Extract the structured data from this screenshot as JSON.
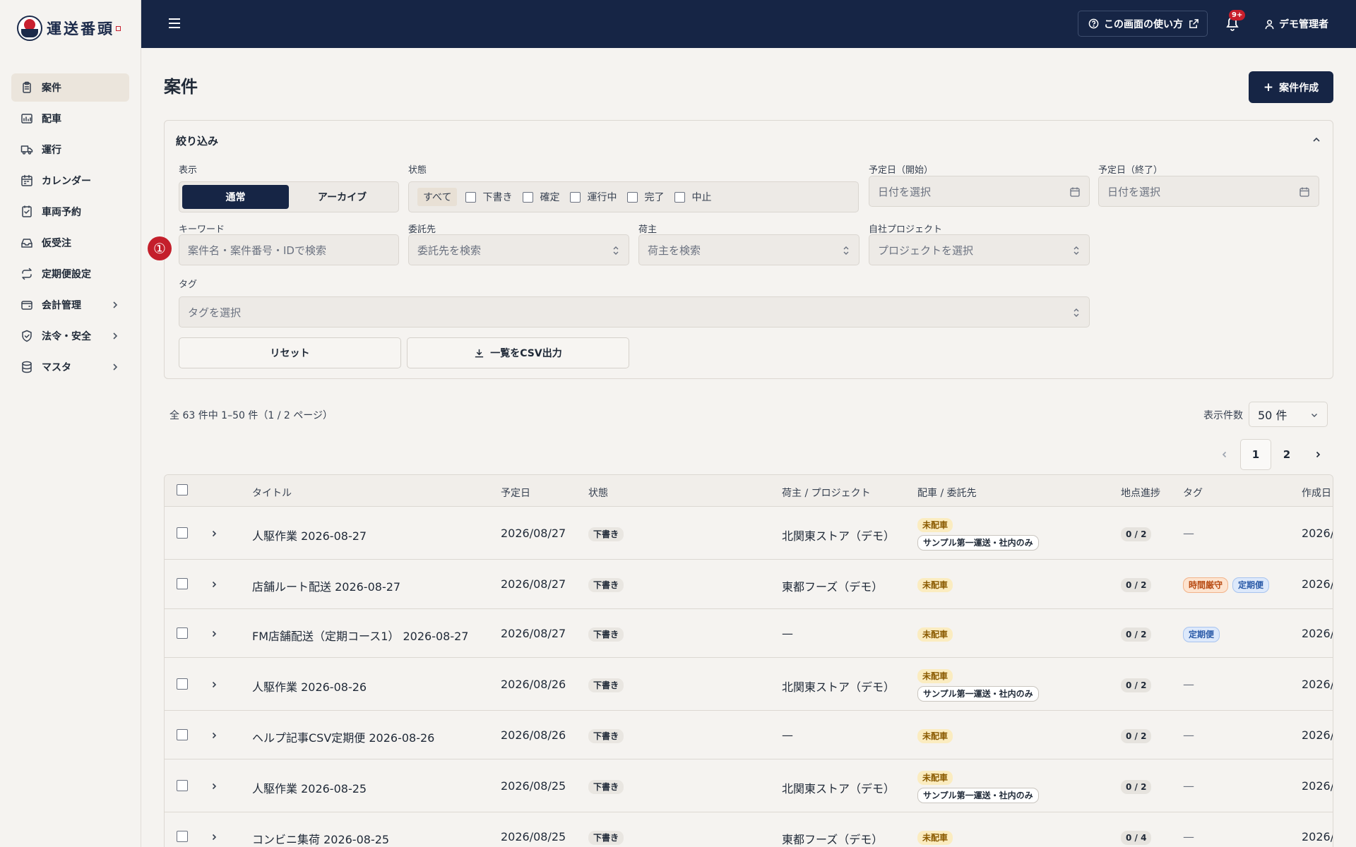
{
  "brand": {
    "name": "運送番頭"
  },
  "sidebar": {
    "items": [
      {
        "label": "案件",
        "icon": "clipboard-icon",
        "active": true,
        "expandable": false
      },
      {
        "label": "配車",
        "icon": "dispatch-map-icon",
        "active": false,
        "expandable": false
      },
      {
        "label": "運行",
        "icon": "truck-icon",
        "active": false,
        "expandable": false
      },
      {
        "label": "カレンダー",
        "icon": "calendar-icon",
        "active": false,
        "expandable": false
      },
      {
        "label": "車両予約",
        "icon": "calendar-check-icon",
        "active": false,
        "expandable": false
      },
      {
        "label": "仮受注",
        "icon": "inbox-icon",
        "active": false,
        "expandable": false
      },
      {
        "label": "定期便設定",
        "icon": "repeat-icon",
        "active": false,
        "expandable": false
      },
      {
        "label": "会計管理",
        "icon": "wallet-icon",
        "active": false,
        "expandable": true
      },
      {
        "label": "法令・安全",
        "icon": "shield-check-icon",
        "active": false,
        "expandable": true
      },
      {
        "label": "マスタ",
        "icon": "database-icon",
        "active": false,
        "expandable": true
      }
    ]
  },
  "topbar": {
    "help_label": "この画面の使い方",
    "notification_badge": "9+",
    "user_name": "デモ管理者"
  },
  "page": {
    "title": "案件",
    "create_label": "案件作成"
  },
  "filter": {
    "title": "絞り込み",
    "display_label": "表示",
    "display_options": [
      "通常",
      "アーカイブ"
    ],
    "display_selected": "通常",
    "status_label": "状態",
    "status_all": "すべて",
    "status_options": [
      "下書き",
      "確定",
      "運行中",
      "完了",
      "中止"
    ],
    "date_start_label": "予定日（開始）",
    "date_start_placeholder": "日付を選択",
    "date_end_label": "予定日（終了）",
    "date_end_placeholder": "日付を選択",
    "keyword_label": "キーワード",
    "keyword_placeholder": "案件名・案件番号・IDで検索",
    "consignor_label": "委託先",
    "consignor_placeholder": "委託先を検索",
    "shipper_label": "荷主",
    "shipper_placeholder": "荷主を検索",
    "project_label": "自社プロジェクト",
    "project_placeholder": "プロジェクトを選択",
    "tag_label": "タグ",
    "tag_placeholder": "タグを選択",
    "reset_label": "リセット",
    "csv_label": "一覧をCSV出力",
    "marker": "①"
  },
  "list": {
    "summary": "全 63 件中 1–50 件（1 / 2 ページ）",
    "per_page_label": "表示件数",
    "per_page_value": "50 件",
    "pages": [
      "1",
      "2"
    ],
    "current_page": "1",
    "columns": {
      "title": "タイトル",
      "date": "予定日",
      "status": "状態",
      "shipper": "荷主 / プロジェクト",
      "dispatch": "配車 / 委託先",
      "progress": "地点進捗",
      "tags": "タグ",
      "created": "作成日"
    },
    "rows": [
      {
        "title": "人駆作業 2026-08-27",
        "date": "2026/08/27",
        "status": "下書き",
        "shipper": "北関東ストア（デモ）",
        "dispatch": "未配車",
        "carrier": "サンプル第一運送・社内のみ",
        "progress": "0 / 2",
        "tags": [],
        "tags_empty": "—",
        "created": "2026/"
      },
      {
        "title": "店舗ルート配送 2026-08-27",
        "date": "2026/08/27",
        "status": "下書き",
        "shipper": "東都フーズ（デモ）",
        "dispatch": "未配車",
        "carrier": "",
        "progress": "0 / 2",
        "tags": [
          "時間厳守",
          "定期便"
        ],
        "tags_empty": "",
        "created": "2026/"
      },
      {
        "title": "FM店舗配送（定期コース1） 2026-08-27",
        "date": "2026/08/27",
        "status": "下書き",
        "shipper": "—",
        "dispatch": "未配車",
        "carrier": "",
        "progress": "0 / 2",
        "tags": [
          "定期便"
        ],
        "tags_empty": "",
        "created": "2026/"
      },
      {
        "title": "人駆作業 2026-08-26",
        "date": "2026/08/26",
        "status": "下書き",
        "shipper": "北関東ストア（デモ）",
        "dispatch": "未配車",
        "carrier": "サンプル第一運送・社内のみ",
        "progress": "0 / 2",
        "tags": [],
        "tags_empty": "—",
        "created": "2026/"
      },
      {
        "title": "ヘルプ記事CSV定期便 2026-08-26",
        "date": "2026/08/26",
        "status": "下書き",
        "shipper": "—",
        "dispatch": "未配車",
        "carrier": "",
        "progress": "0 / 2",
        "tags": [],
        "tags_empty": "—",
        "created": "2026/"
      },
      {
        "title": "人駆作業 2026-08-25",
        "date": "2026/08/25",
        "status": "下書き",
        "shipper": "北関東ストア（デモ）",
        "dispatch": "未配車",
        "carrier": "サンプル第一運送・社内のみ",
        "progress": "0 / 2",
        "tags": [],
        "tags_empty": "—",
        "created": "2026/"
      },
      {
        "title": "コンビニ集荷 2026-08-25",
        "date": "2026/08/25",
        "status": "下書き",
        "shipper": "東都フーズ（デモ）",
        "dispatch": "未配車",
        "carrier": "",
        "progress": "0 / 4",
        "tags": [],
        "tags_empty": "—",
        "created": "2026/"
      }
    ]
  }
}
